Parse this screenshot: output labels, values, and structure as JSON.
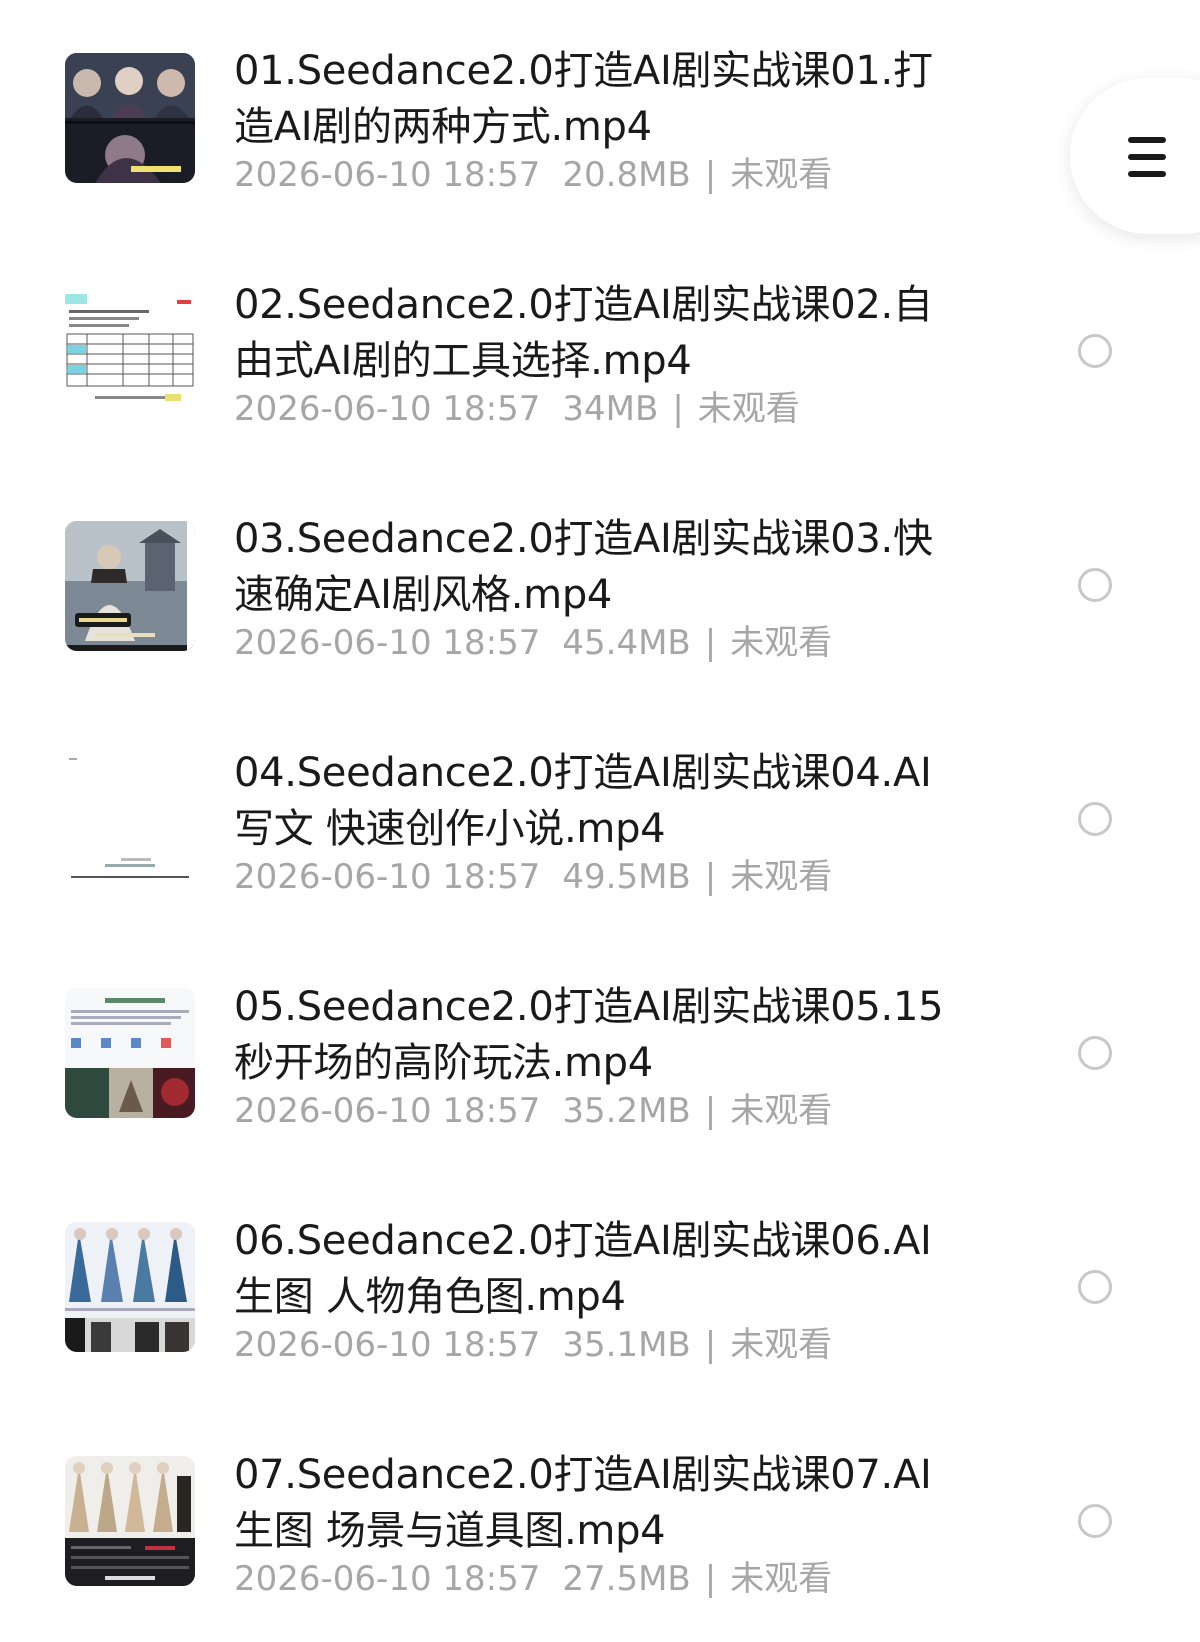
{
  "files": [
    {
      "name": "01.Seedance2.0打造AI剧实战课01.打造AI剧的两种方式.mp4",
      "date": "2026-06-10 18:57",
      "size": "20.8MB",
      "status": "未观看",
      "thumb_icon": "anime-characters-thumbnail"
    },
    {
      "name": "02.Seedance2.0打造AI剧实战课02.自由式AI剧的工具选择.mp4",
      "date": "2026-06-10 18:57",
      "size": "34MB",
      "status": "未观看",
      "thumb_icon": "spreadsheet-thumbnail"
    },
    {
      "name": "03.Seedance2.0打造AI剧实战课03.快速确定AI剧风格.mp4",
      "date": "2026-06-10 18:57",
      "size": "45.4MB",
      "status": "未观看",
      "thumb_icon": "warrior-scene-thumbnail"
    },
    {
      "name": "04.Seedance2.0打造AI剧实战课04.AI写文 快速创作小说.mp4",
      "date": "2026-06-10 18:57",
      "size": "49.5MB",
      "status": "未观看",
      "thumb_icon": "blank-document-thumbnail"
    },
    {
      "name": "05.Seedance2.0打造AI剧实战课05.15秒开场的高阶玩法.mp4",
      "date": "2026-06-10 18:57",
      "size": "35.2MB",
      "status": "未观看",
      "thumb_icon": "webpage-images-thumbnail"
    },
    {
      "name": "06.Seedance2.0打造AI剧实战课06.AI生图 人物角色图.mp4",
      "date": "2026-06-10 18:57",
      "size": "35.1MB",
      "status": "未观看",
      "thumb_icon": "character-gallery-thumbnail"
    },
    {
      "name": "07.Seedance2.0打造AI剧实战课07.AI生图 场景与道具图.mp4",
      "date": "2026-06-10 18:57",
      "size": "27.5MB",
      "status": "未观看",
      "thumb_icon": "scene-props-thumbnail"
    }
  ],
  "meta_separator": "|",
  "menu_icon": "hamburger-menu-icon"
}
